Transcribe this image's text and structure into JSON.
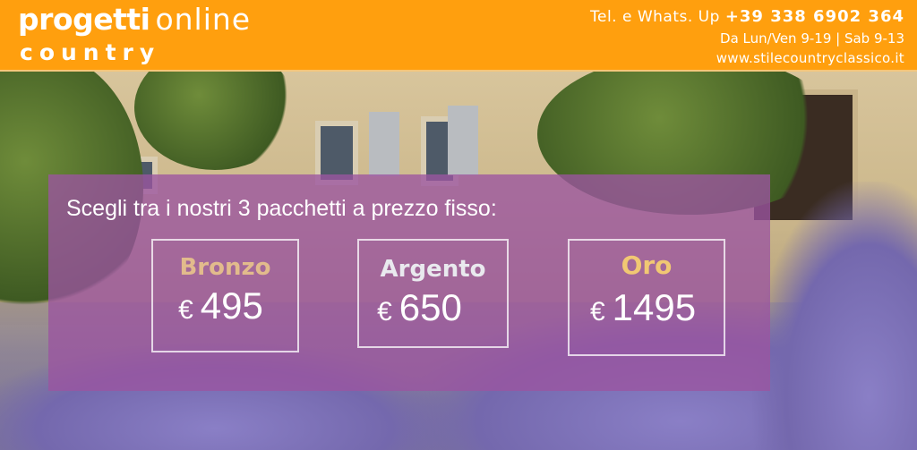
{
  "header": {
    "logo_bold": "progetti",
    "logo_light": "online",
    "logo_sub": "country",
    "phone_prefix": "Tel. e Whats. Up",
    "phone_number": "+39 338 6902 364",
    "hours": "Da Lun/Ven 9-19 | Sab 9-13",
    "website": "www.stilecountryclassico.it"
  },
  "panel": {
    "title": "Scegli tra i nostri 3 pacchetti a prezzo fisso:",
    "packages": [
      {
        "name": "Bronzo",
        "currency": "€",
        "price": "495",
        "name_color": "#e2bb8c"
      },
      {
        "name": "Argento",
        "currency": "€",
        "price": "650",
        "name_color": "#e9e9ee"
      },
      {
        "name": "Oro",
        "currency": "€",
        "price": "1495",
        "name_color": "#f1c873"
      }
    ]
  },
  "colors": {
    "header_bg": "#ff9f0e",
    "panel_bg": "#9b55a0"
  }
}
